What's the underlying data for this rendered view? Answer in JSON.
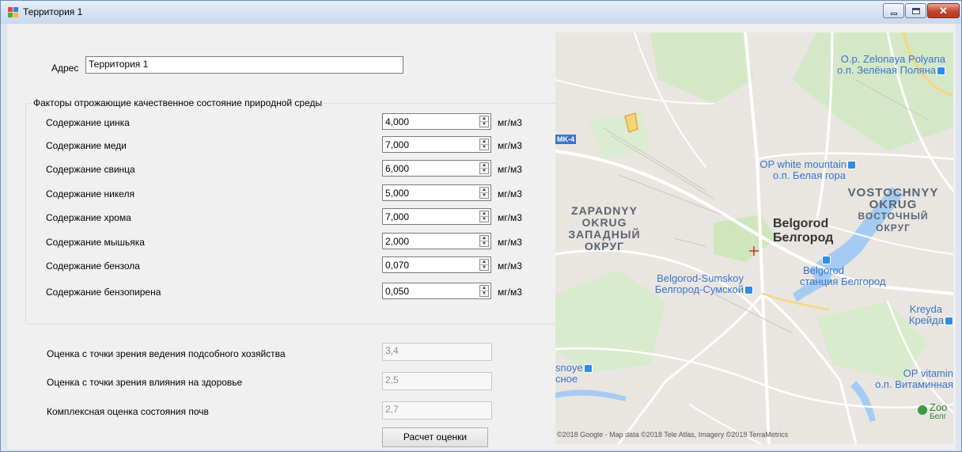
{
  "window": {
    "title": "Территория 1",
    "close_glyph": "✕"
  },
  "address": {
    "label": "Адрес",
    "value": "Территория 1"
  },
  "factors": {
    "group_title": "Факторы отрожающие качественное состояние природной среды",
    "unit": "мг/м3",
    "items": [
      {
        "label": "Содержание цинка",
        "value": "4,000"
      },
      {
        "label": "Содержание меди",
        "value": "7,000"
      },
      {
        "label": "Содержание свинца",
        "value": "6,000"
      },
      {
        "label": "Содержание никеля",
        "value": "5,000"
      },
      {
        "label": "Содержание хрома",
        "value": "7,000"
      },
      {
        "label": "Содержание мышьяка",
        "value": "2,000"
      },
      {
        "label": "Содержание бензола",
        "value": "0,070"
      },
      {
        "label": "Содержание бензопирена",
        "value": "0,050"
      }
    ]
  },
  "results": [
    {
      "label": "Оценка с точки зрения ведения подсобного хозяйства",
      "value": "3,4"
    },
    {
      "label": "Оценка с точки зрения влияния на здоровье",
      "value": "2,5"
    },
    {
      "label": "Комплексная оценка состояния почв",
      "value": "2,7"
    }
  ],
  "calc_button": "Расчет оценки",
  "map": {
    "road_sign": "MK-4",
    "labels": {
      "zelonaya_en": "O.p. Zelonaya Polyana",
      "zelonaya_ru": "о.п. Зелёная Поляна",
      "white_en": "OP white mountain",
      "white_ru": "о.п. Белая гора",
      "vostochnyy_en_1": "VOSTOCHNYY",
      "vostochnyy_en_2": "OKRUG",
      "vostochnyy_ru_1": "ВОСТОЧНЫЙ",
      "vostochnyy_ru_2": "ОКРУГ",
      "zapadnyy_en_1": "ZAPADNYY",
      "zapadnyy_en_2": "OKRUG",
      "zapadnyy_ru_1": "ЗАПАДНЫЙ",
      "zapadnyy_ru_2": "ОКРУГ",
      "city_en": "Belgorod",
      "city_ru": "Белгород",
      "station_en": "Belgorod",
      "station_ru": "станция Белгород",
      "sumskoy_en": "Belgorod-Sumskoy",
      "sumskoy_ru": "Белгород-Сумской",
      "kreyda_en": "Kreyda",
      "kreyda_ru": "Крейда",
      "snoye_en": "snoye",
      "snoye_ru": "сное",
      "vitamin_en": "OP vitamin",
      "vitamin_ru": "о.п. Витаминная",
      "zoo_en": "Zoo",
      "zoo_ru": "Белг"
    },
    "copyright": "©2018 Google - Map data ©2018 Tele Atlas, Imagery ©2018 TerraMetrics"
  },
  "colors": {
    "map_land": "#e9e6e1",
    "map_green": "#cfe7c4",
    "map_water": "#a6cbf3",
    "poi_blue": "#2f8de4",
    "label_blue": "#3b73c7"
  }
}
